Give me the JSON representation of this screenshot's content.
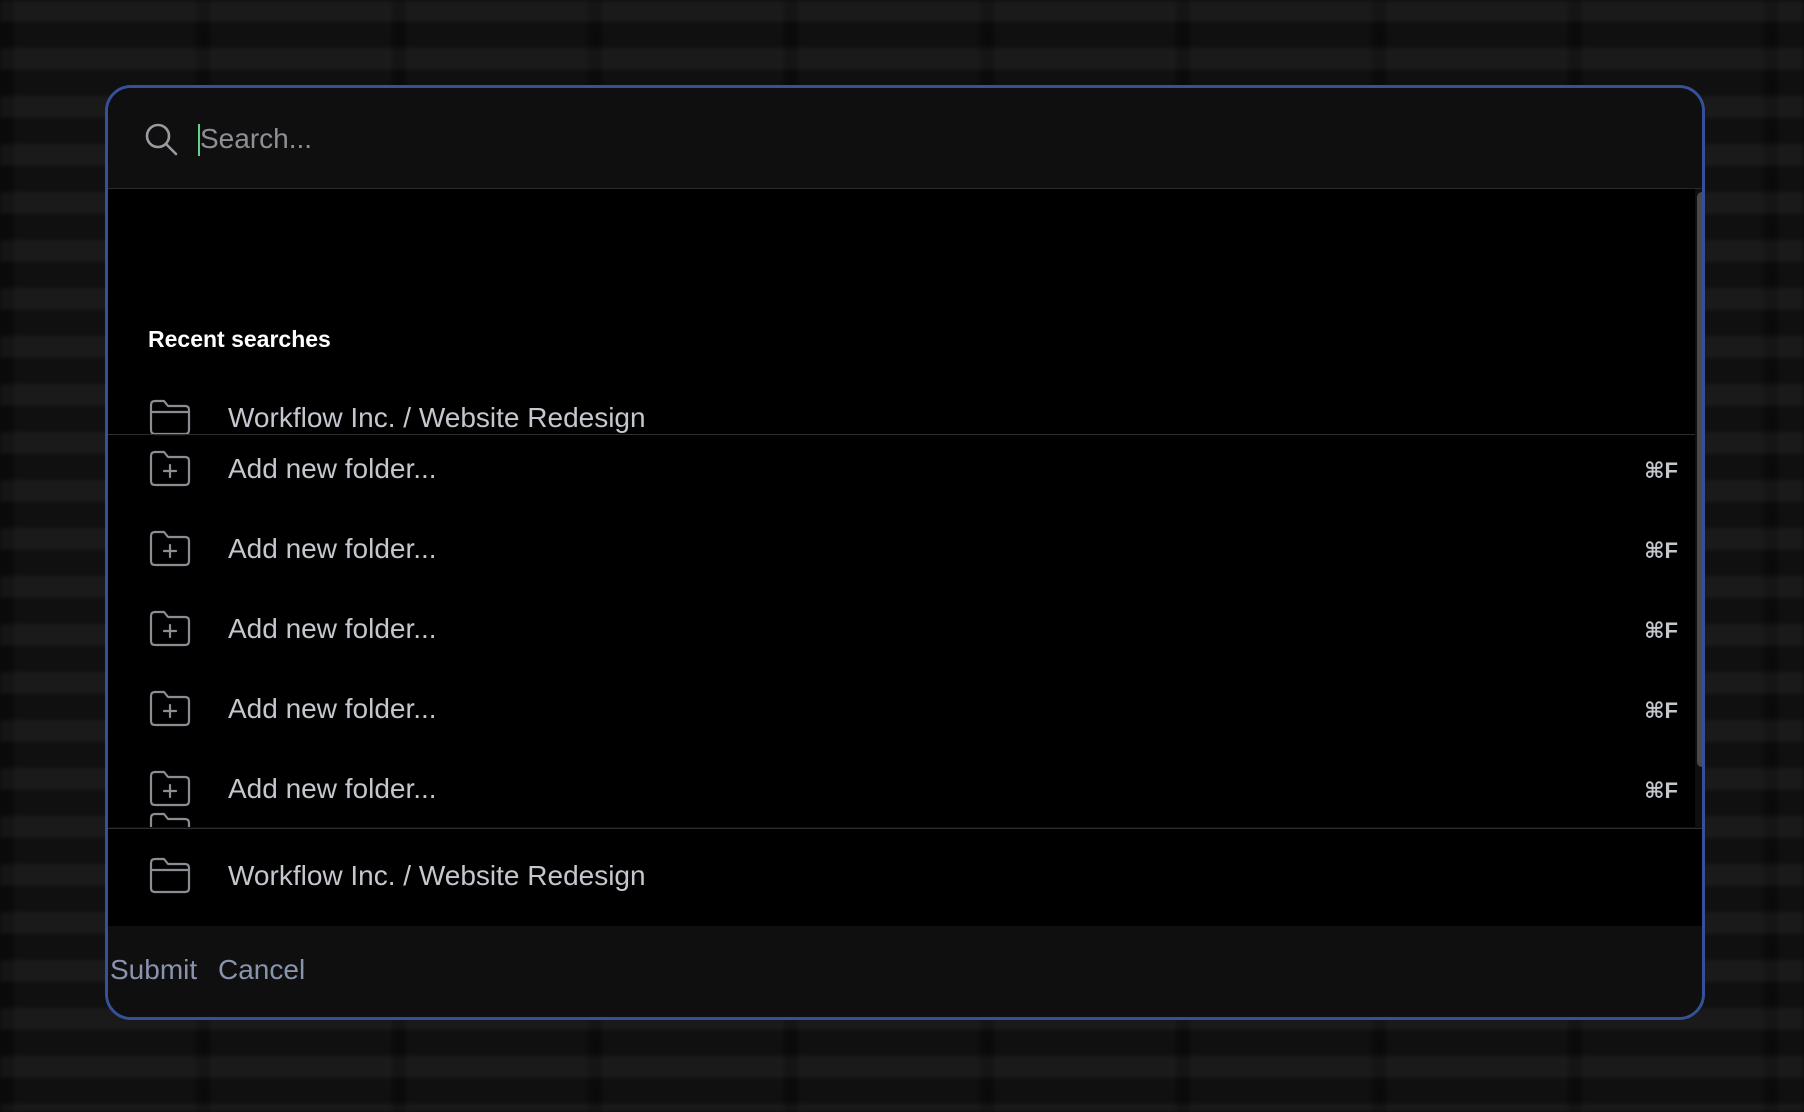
{
  "search": {
    "placeholder": "Search...",
    "value": ""
  },
  "recent": {
    "title": "Recent searches",
    "items": [
      {
        "label": "Workflow Inc. / Website Redesign",
        "icon": "folder-icon"
      }
    ]
  },
  "actions": [
    {
      "label": "Add new folder...",
      "shortcut": "⌘F",
      "icon": "folder-plus-icon"
    },
    {
      "label": "Add new folder...",
      "shortcut": "⌘F",
      "icon": "folder-plus-icon"
    },
    {
      "label": "Add new folder...",
      "shortcut": "⌘F",
      "icon": "folder-plus-icon"
    },
    {
      "label": "Add new folder...",
      "shortcut": "⌘F",
      "icon": "folder-plus-icon"
    },
    {
      "label": "Add new folder...",
      "shortcut": "⌘F",
      "icon": "folder-plus-icon"
    }
  ],
  "pinned": {
    "label": "Workflow Inc. / Website Redesign",
    "icon": "folder-icon"
  },
  "footer": {
    "submit_label": "Submit",
    "cancel_label": "Cancel"
  },
  "colors": {
    "accent_border": "#34519a",
    "caret": "#5fd38a",
    "footer_link": "#8a93ad"
  }
}
